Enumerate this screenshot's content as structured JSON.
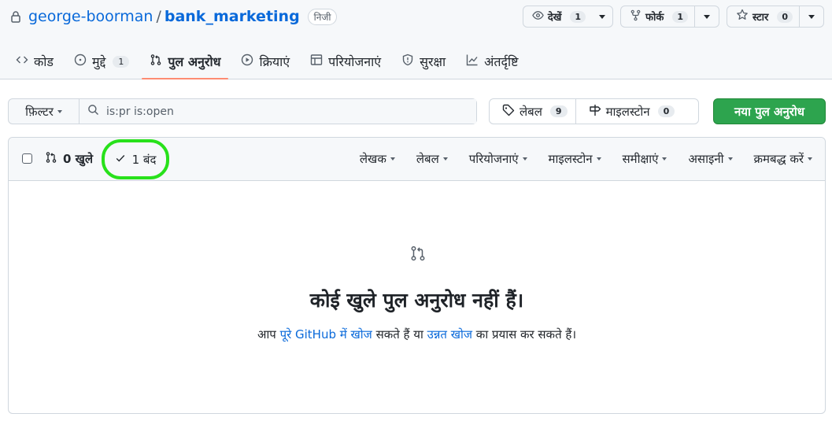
{
  "repo": {
    "owner": "george-boorman",
    "separator": "/",
    "name": "bank_marketing",
    "visibility": "निजी"
  },
  "actions": {
    "watch": {
      "label": "देखें",
      "count": "1"
    },
    "fork": {
      "label": "फोर्क",
      "count": "1"
    },
    "star": {
      "label": "स्टार",
      "count": "0"
    }
  },
  "tabs": [
    {
      "label": "कोड",
      "icon": "code-icon"
    },
    {
      "label": "मुद्दे",
      "count": "1",
      "icon": "issue-icon"
    },
    {
      "label": "पुल अनुरोध",
      "icon": "pull-request-icon",
      "active": true
    },
    {
      "label": "क्रियाएं",
      "icon": "play-icon"
    },
    {
      "label": "परियोजनाएं",
      "icon": "table-icon"
    },
    {
      "label": "सुरक्षा",
      "icon": "shield-icon"
    },
    {
      "label": "अंतर्दृष्टि",
      "icon": "graph-icon"
    }
  ],
  "filter": {
    "button": "फ़िल्टर",
    "query": "is:pr is:open"
  },
  "labels": {
    "label": "लेबल",
    "count": "9"
  },
  "milestones": {
    "label": "माइलस्टोन",
    "count": "0"
  },
  "new_pr": "नया पुल अनुरोध",
  "list": {
    "open_label": "0 खुले",
    "closed_label": "1 बंद",
    "sorts": [
      "लेखक",
      "लेबल",
      "परियोजनाएं",
      "माइलस्टोन",
      "समीक्षाएं",
      "असाइनी",
      "क्रमबद्ध करें"
    ]
  },
  "blank": {
    "title": "कोई खुले पुल अनुरोध नहीं हैं।",
    "desc_pre": "आप",
    "link1": "पूरे GitHub में खोज",
    "desc_mid": "सकते हैं या",
    "link2": "उन्नत खोज",
    "desc_post": "का प्रयास कर सकते हैं।"
  },
  "colors": {
    "accent": "#0969da",
    "primary_button": "#2da44e",
    "tab_underline": "#fd8c73",
    "highlight_circle": "#28e11b"
  }
}
